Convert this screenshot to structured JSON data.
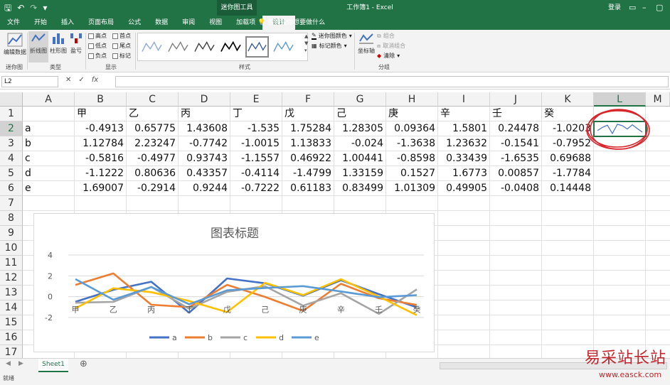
{
  "window": {
    "title": "工作簿1 - Excel",
    "context_tool": "迷你图工具",
    "login": "登录"
  },
  "ribbon": {
    "tabs": [
      "文件",
      "开始",
      "插入",
      "页面布局",
      "公式",
      "数据",
      "审阅",
      "视图",
      "加载项",
      "设计"
    ],
    "active_tab": "设计",
    "tell_me": "告诉我你想要做什么",
    "groups": {
      "sparkline": {
        "label": "迷你图",
        "edit_data": "编辑数据"
      },
      "type": {
        "label": "类型",
        "line": "折线图",
        "column": "柱形图",
        "winloss": "盈亏"
      },
      "show": {
        "label": "显示",
        "high": "高点",
        "low": "低点",
        "negative": "负点",
        "first": "首点",
        "last": "尾点",
        "markers": "标记"
      },
      "style": {
        "label": "样式",
        "sparkline_color": "迷你图颜色",
        "marker_color": "标记颜色"
      },
      "group": {
        "label": "分组",
        "axis": "坐标轴",
        "group": "组合",
        "ungroup": "取消组合",
        "clear": "清除"
      }
    }
  },
  "formula_bar": {
    "name_box": "L2",
    "formula": ""
  },
  "grid": {
    "columns": [
      "A",
      "B",
      "C",
      "D",
      "E",
      "F",
      "G",
      "H",
      "I",
      "J",
      "K",
      "L",
      "M"
    ],
    "rows": [
      "1",
      "2",
      "3",
      "4",
      "5",
      "6",
      "7",
      "8",
      "9",
      "10",
      "11",
      "12",
      "13",
      "14",
      "15",
      "16",
      "17"
    ],
    "selected_col": "L",
    "selected_row": "2",
    "header_row": [
      "",
      "甲",
      "乙",
      "丙",
      "丁",
      "戊",
      "己",
      "庚",
      "辛",
      "壬",
      "癸"
    ],
    "data_rows": [
      [
        "a",
        "-0.4913",
        "0.65775",
        "1.43608",
        "-1.535",
        "1.75284",
        "1.28305",
        "0.09364",
        "1.5801",
        "0.24478",
        "-1.0203"
      ],
      [
        "b",
        "1.12784",
        "2.23247",
        "-0.7742",
        "-1.0015",
        "1.13833",
        "-0.024",
        "-1.3638",
        "1.23632",
        "-0.1541",
        "-0.7952"
      ],
      [
        "c",
        "-0.5816",
        "-0.4977",
        "0.93743",
        "-1.1557",
        "0.46922",
        "1.00441",
        "-0.8598",
        "0.33439",
        "-1.6535",
        "0.69688"
      ],
      [
        "d",
        "-1.1222",
        "0.80636",
        "0.43357",
        "-0.4114",
        "-1.4799",
        "1.33159",
        "0.1527",
        "1.6773",
        "0.00857",
        "-1.7784"
      ],
      [
        "e",
        "1.69007",
        "-0.2914",
        "0.9244",
        "-0.7222",
        "0.61183",
        "0.83499",
        "1.01309",
        "0.49905",
        "-0.0408",
        "0.14448"
      ]
    ]
  },
  "chart_data": {
    "type": "line",
    "title": "图表标题",
    "categories": [
      "甲",
      "乙",
      "丙",
      "丁",
      "戊",
      "己",
      "庚",
      "辛",
      "壬",
      "癸"
    ],
    "ylim": [
      -2,
      4
    ],
    "yticks": [
      "4",
      "2",
      "0",
      "-2"
    ],
    "grid": true,
    "legend": "bottom",
    "series": [
      {
        "name": "a",
        "color": "#4472c4",
        "values": [
          -0.4913,
          0.65775,
          1.43608,
          -1.535,
          1.75284,
          1.28305,
          0.09364,
          1.5801,
          0.24478,
          -1.0203
        ]
      },
      {
        "name": "b",
        "color": "#ed7d31",
        "values": [
          1.12784,
          2.23247,
          -0.7742,
          -1.0015,
          1.13833,
          -0.024,
          -1.3638,
          1.23632,
          -0.1541,
          -0.7952
        ]
      },
      {
        "name": "c",
        "color": "#a5a5a5",
        "values": [
          -0.5816,
          -0.4977,
          0.93743,
          -1.1557,
          0.46922,
          1.00441,
          -0.8598,
          0.33439,
          -1.6535,
          0.69688
        ]
      },
      {
        "name": "d",
        "color": "#ffc000",
        "values": [
          -1.1222,
          0.80636,
          0.43357,
          -0.4114,
          -1.4799,
          1.33159,
          0.1527,
          1.6773,
          0.00857,
          -1.7784
        ]
      },
      {
        "name": "e",
        "color": "#5b9bd5",
        "values": [
          1.69007,
          -0.2914,
          0.9244,
          -0.7222,
          0.61183,
          0.83499,
          1.01309,
          0.49905,
          -0.0408,
          0.14448
        ]
      }
    ]
  },
  "sparkline": {
    "cell": "L2",
    "values": [
      -0.4913,
      0.65775,
      1.43608,
      -1.535,
      1.75284,
      1.28305,
      0.09364,
      1.5801,
      0.24478,
      -1.0203
    ],
    "color": "#4472c4",
    "highlight_color": "#d9262b"
  },
  "sheets": {
    "tabs": [
      "Sheet1"
    ],
    "active": "Sheet1"
  },
  "status": {
    "text": "就绪"
  },
  "watermark": {
    "text": "易采站长站",
    "url": "www.easck.com",
    "color": "#c0262b"
  },
  "colors": {
    "excel_green": "#217346"
  }
}
